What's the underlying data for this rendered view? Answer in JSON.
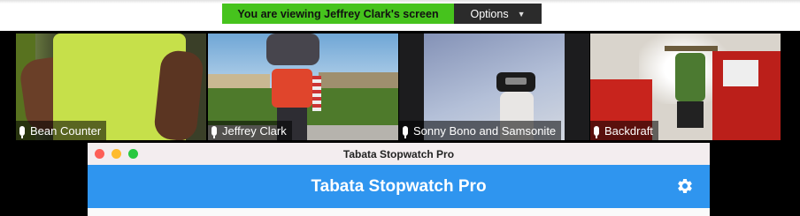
{
  "screen_share": {
    "banner_text": "You are viewing Jeffrey Clark's screen",
    "options_label": "Options",
    "banner_color": "#46c31d"
  },
  "participants": [
    {
      "name": "Bean Counter"
    },
    {
      "name": "Jeffrey Clark"
    },
    {
      "name": "Sonny Bono and Samsonite"
    },
    {
      "name": "Backdraft"
    }
  ],
  "app_window": {
    "window_title": "Tabata Stopwatch Pro",
    "header_title": "Tabata Stopwatch Pro",
    "accent_color": "#2f95ef",
    "settings_icon": "gear-icon"
  }
}
